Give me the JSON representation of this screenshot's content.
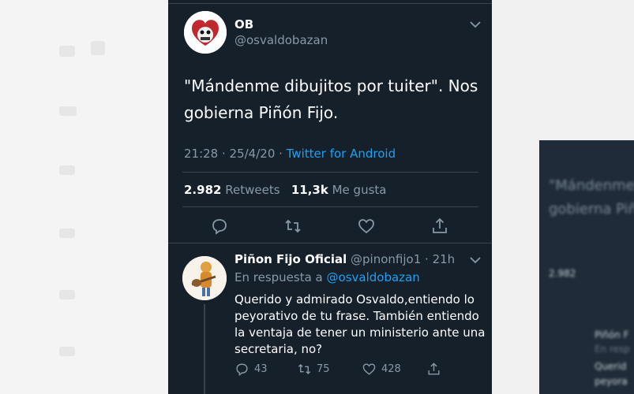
{
  "tweet": {
    "author_name": "OB",
    "author_handle": "@osvaldobazan",
    "text_line1": "\"Mándenme dibujitos por tuiter\". Nos",
    "text_line2": "gobierna Piñón Fijo.",
    "time": "21:28 · 25/4/20 · ",
    "source": "Twitter for Android",
    "retweets_count": "2.982",
    "retweets_label": "Retweets",
    "likes_count": "11,3k",
    "likes_label": "Me gusta"
  },
  "reply": {
    "author_name": "Piñon Fijo Oficial",
    "author_handle": "@pinonfijo1",
    "time": "· 21h",
    "reply_prefix": "En respuesta a",
    "reply_mention": "@osvaldobazan",
    "text": "Querido y admirado Osvaldo,entiendo lo peyorativo de tu frase. También entiendo la ventaja de tener un ministerio ante una secretaria, no?",
    "replies": "43",
    "retweets": "75",
    "likes": "428"
  },
  "background_right": {
    "text_line1": "\"Mándenme",
    "text_line2": "gobierna Piñ",
    "count": "2.982",
    "reply_name": "Piñón F",
    "reply_prefix": "En resp",
    "reply_text1": "Querid",
    "reply_text2": "peyora"
  },
  "colors": {
    "panel_bg": "#15202b",
    "accent": "#1da1f2",
    "muted": "#8899a6",
    "divider": "#38444d"
  },
  "icons": [
    "chevron-down-icon",
    "reply-icon",
    "retweet-icon",
    "like-icon",
    "share-icon"
  ]
}
